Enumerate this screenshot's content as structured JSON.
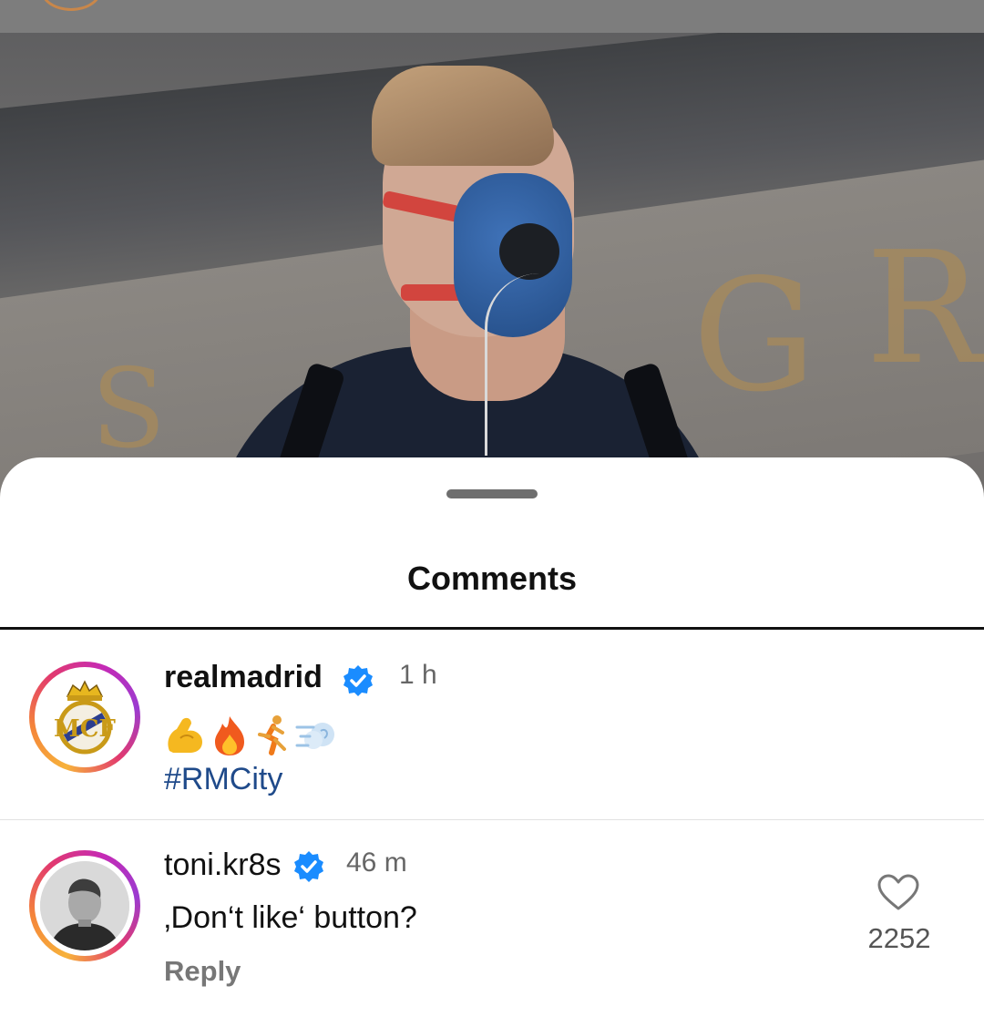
{
  "sheet": {
    "title": "Comments"
  },
  "comments": [
    {
      "username": "realmadrid",
      "verified": true,
      "time": "1 h",
      "emojis": [
        "flexed-biceps",
        "fire",
        "person-running",
        "dashing-away"
      ],
      "hashtag": "#RMCity",
      "avatar": "real-madrid-crest"
    },
    {
      "username": "toni.kr8s",
      "verified": true,
      "time": "46 m",
      "text": "‚Don‘t like‘ button?",
      "reply_label": "Reply",
      "like_count": "2252",
      "avatar": "profile-photo"
    }
  ],
  "colors": {
    "verified_badge": "#1a8cff",
    "hashtag": "#1f4a8a",
    "story_ring_start": "#f7b23b",
    "story_ring_end": "#c52ab5"
  }
}
